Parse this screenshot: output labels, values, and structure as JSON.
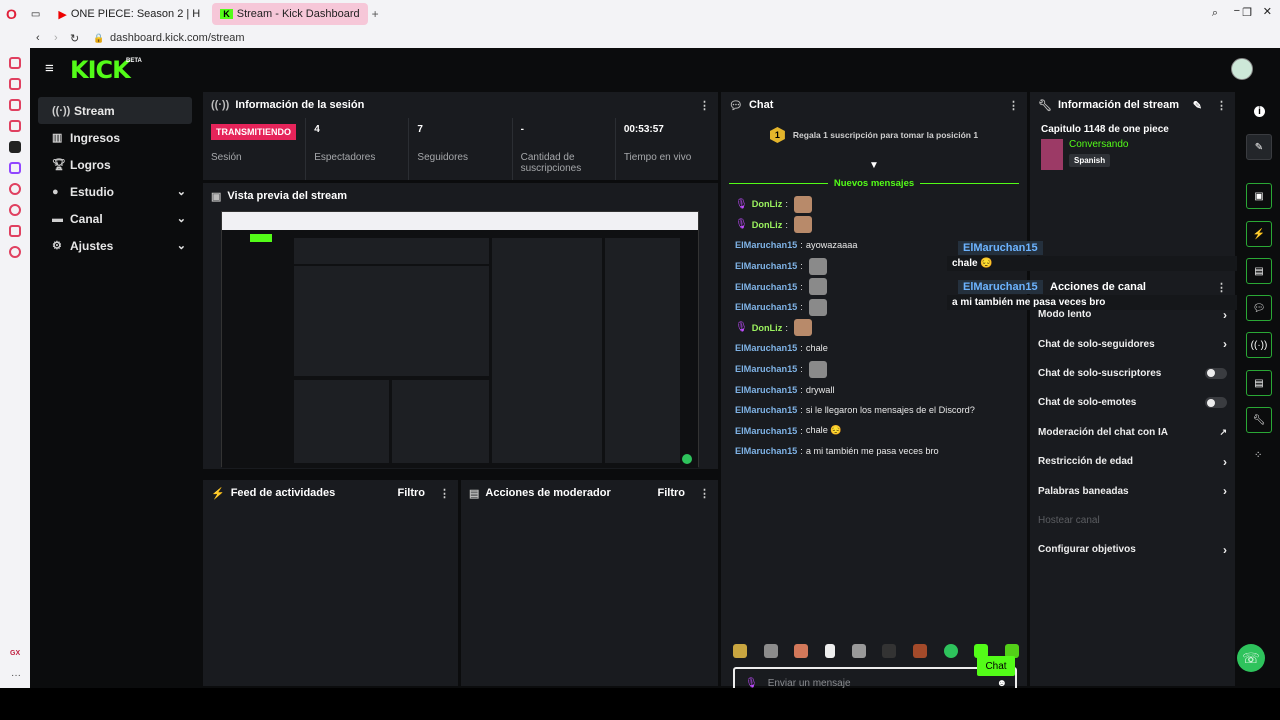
{
  "browser": {
    "tabs": [
      {
        "label": "ONE PIECE: Season 2 | H"
      },
      {
        "label": "Stream - Kick Dashboard"
      }
    ],
    "url": "dashboard.kick.com/stream",
    "left_label": "GX"
  },
  "app": {
    "logo": "KICK",
    "beta": "BETA"
  },
  "sidebar": {
    "items": [
      {
        "label": "Stream"
      },
      {
        "label": "Ingresos"
      },
      {
        "label": "Logros"
      },
      {
        "label": "Estudio"
      },
      {
        "label": "Canal"
      },
      {
        "label": "Ajustes"
      }
    ]
  },
  "session": {
    "title": "Información de la sesión",
    "live_badge": "TRANSMITIENDO",
    "stats": [
      {
        "value": "",
        "label": "Sesión"
      },
      {
        "value": "4",
        "label": "Espectadores"
      },
      {
        "value": "7",
        "label": "Seguidores"
      },
      {
        "value": "-",
        "label": "Cantidad de suscripciones"
      },
      {
        "value": "00:53:57",
        "label": "Tiempo en vivo"
      }
    ]
  },
  "preview": {
    "title": "Vista previa del stream"
  },
  "activity": {
    "title": "Feed de actividades",
    "filter": "Filtro"
  },
  "mod": {
    "title": "Acciones de moderador",
    "filter": "Filtro"
  },
  "chat": {
    "title": "Chat",
    "sub_rank": "1",
    "sub_prompt": "Regala 1 suscripción para tomar la posición 1",
    "new_messages": "Nuevos mensajes",
    "messages": [
      {
        "user": "DonLiz",
        "text": "",
        "emote": true
      },
      {
        "user": "DonLiz",
        "text": "",
        "emote": true
      },
      {
        "user": "ElMaruchan15",
        "text": "ayowazaaaa",
        "emote": false
      },
      {
        "user": "ElMaruchan15",
        "text": "",
        "emote": true
      },
      {
        "user": "ElMaruchan15",
        "text": "",
        "emote": true
      },
      {
        "user": "ElMaruchan15",
        "text": "",
        "emote": true
      },
      {
        "user": "DonLiz",
        "text": "",
        "emote": true
      },
      {
        "user": "ElMaruchan15",
        "text": "chale",
        "emote": false
      },
      {
        "user": "ElMaruchan15",
        "text": "",
        "emote": true
      },
      {
        "user": "ElMaruchan15",
        "text": "drywall",
        "emote": false
      },
      {
        "user": "ElMaruchan15",
        "text": "si le llegaron los mensajes de el Discord?",
        "emote": false
      },
      {
        "user": "ElMaruchan15",
        "text": "chale 😔",
        "emote": false
      },
      {
        "user": "ElMaruchan15",
        "text": "a mi también me pasa veces bro",
        "emote": false
      }
    ],
    "input_placeholder": "Enviar un mensaje",
    "send_label": "Chat"
  },
  "overlay": [
    {
      "user": "ElMaruchan15",
      "text": "chale 😔"
    },
    {
      "user": "ElMaruchan15",
      "text": "a mi también me pasa veces bro"
    }
  ],
  "stream_info": {
    "title": "Información del stream",
    "stream_title": "Capitulo 1148 de one piece",
    "category": "Conversando",
    "language": "Spanish"
  },
  "channel_actions": {
    "title": "Acciones de canal",
    "items": [
      {
        "label": "Modo lento",
        "control": "chevron"
      },
      {
        "label": "Chat de solo-seguidores",
        "control": "chevron"
      },
      {
        "label": "Chat de solo-suscriptores",
        "control": "toggle"
      },
      {
        "label": "Chat de solo-emotes",
        "control": "toggle"
      },
      {
        "label": "Moderación del chat con IA",
        "control": "external"
      },
      {
        "label": "Restricción de edad",
        "control": "chevron"
      },
      {
        "label": "Palabras baneadas",
        "control": "chevron"
      },
      {
        "label": "Hostear canal",
        "control": "none"
      },
      {
        "label": "Configurar objetivos",
        "control": "chevron"
      }
    ]
  },
  "colors": {
    "brand": "#53fc18",
    "live": "#e6245a",
    "username": "#7fb3e6"
  }
}
